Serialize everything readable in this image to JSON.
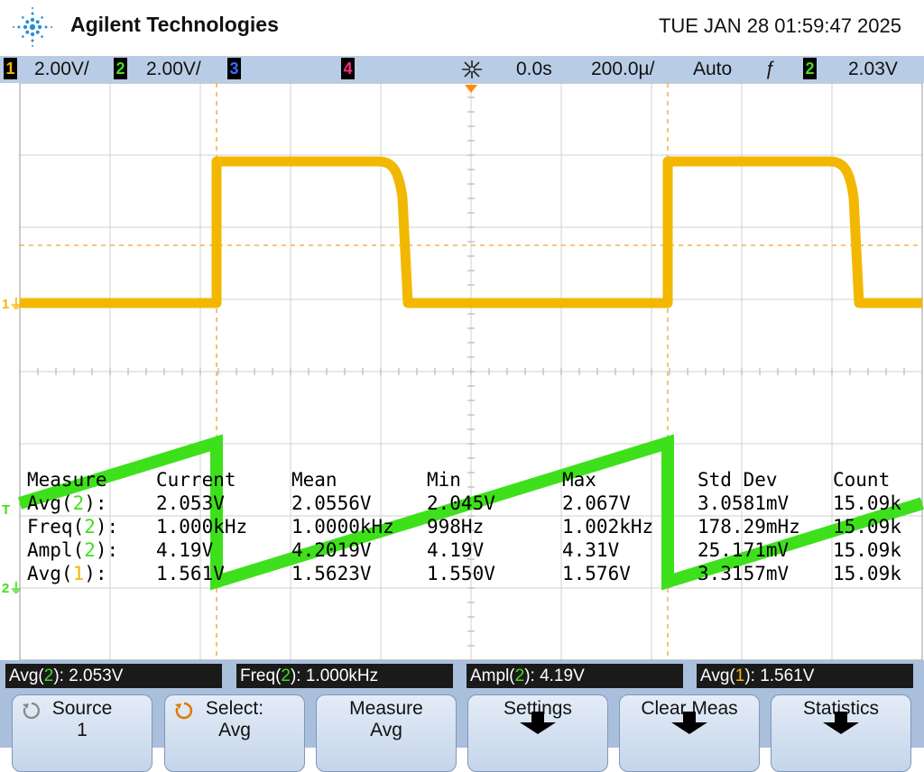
{
  "header": {
    "brand": "Agilent Technologies",
    "datetime": "TUE JAN 28 01:59:47 2025"
  },
  "statusbar": {
    "ch1_num": "1",
    "ch1_scale": "2.00V/",
    "ch2_num": "2",
    "ch2_scale": "2.00V/",
    "ch3_num": "3",
    "ch4_num": "4",
    "time_offset": "0.0s",
    "timebase": "200.0µ/",
    "trigger_mode": "Auto",
    "trigger_slope": "ƒ",
    "trigger_ch": "2",
    "trigger_level": "2.03V"
  },
  "markers": {
    "ch1": "1",
    "ch2": "2",
    "trigger": "T"
  },
  "measurements": {
    "headers": [
      "Measure",
      "Current",
      "Mean",
      "Min",
      "Max",
      "Std Dev",
      "Count"
    ],
    "rows": [
      {
        "name": "Avg",
        "ch": "2",
        "suffix": "):",
        "current": "2.053V",
        "mean": "2.0556V",
        "min": "2.045V",
        "max": "2.067V",
        "stddev": "3.0581mV",
        "count": "15.09k"
      },
      {
        "name": "Freq",
        "ch": "2",
        "suffix": "):",
        "current": "1.000kHz",
        "mean": "1.0000kHz",
        "min": "998Hz",
        "max": "1.002kHz",
        "stddev": "178.29mHz",
        "count": "15.09k"
      },
      {
        "name": "Ampl",
        "ch": "2",
        "suffix": "):",
        "current": "4.19V",
        "mean": "4.2019V",
        "min": "4.19V",
        "max": "4.31V",
        "stddev": "25.171mV",
        "count": "15.09k"
      },
      {
        "name": "Avg",
        "ch": "1",
        "suffix": "):",
        "current": "1.561V",
        "mean": "1.5623V",
        "min": "1.550V",
        "max": "1.576V",
        "stddev": "3.3157mV",
        "count": "15.09k"
      }
    ]
  },
  "meas_boxes": [
    {
      "name": "Avg(",
      "ch": "2",
      "rest": "): 2.053V"
    },
    {
      "name": "Freq(",
      "ch": "2",
      "rest": "): 1.000kHz"
    },
    {
      "name": "Ampl(",
      "ch": "2",
      "rest": "): 4.19V"
    },
    {
      "name": "Avg(",
      "ch": "1",
      "rest": "): 1.561V"
    }
  ],
  "softkeys": [
    {
      "line1": "Source",
      "line2": "1"
    },
    {
      "line1": "Select:",
      "line2": "Avg"
    },
    {
      "line1": "Measure",
      "line2": "Avg"
    },
    {
      "line1": "Settings",
      "line2": ""
    },
    {
      "line1": "Clear Meas",
      "line2": ""
    },
    {
      "line1": "Statistics",
      "line2": ""
    }
  ],
  "colors": {
    "ch1": "#f2b800",
    "ch2": "#3ee01c",
    "ch3": "#3a6bff",
    "ch4": "#ff2a7a",
    "trigger_marker": "#ff8c00"
  }
}
